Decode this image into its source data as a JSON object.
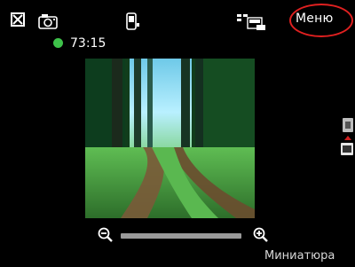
{
  "topbar": {
    "menu_label": "Меню"
  },
  "status": {
    "recording_time": "73:15",
    "indicator_color": "#3ec24a"
  },
  "icons": {
    "close": "close-icon",
    "camera": "camera-icon",
    "phone": "phone-icon",
    "resolution": "resolution-icon",
    "zoom_out": "zoom-out-icon",
    "zoom_in": "zoom-in-icon",
    "mode_switch": "mode-switch-icon"
  },
  "softkeys": {
    "right": "Миниатюра"
  },
  "colors": {
    "background": "#000000",
    "highlight_circle": "#e02020",
    "zoom_track": "#9a9a9a"
  }
}
